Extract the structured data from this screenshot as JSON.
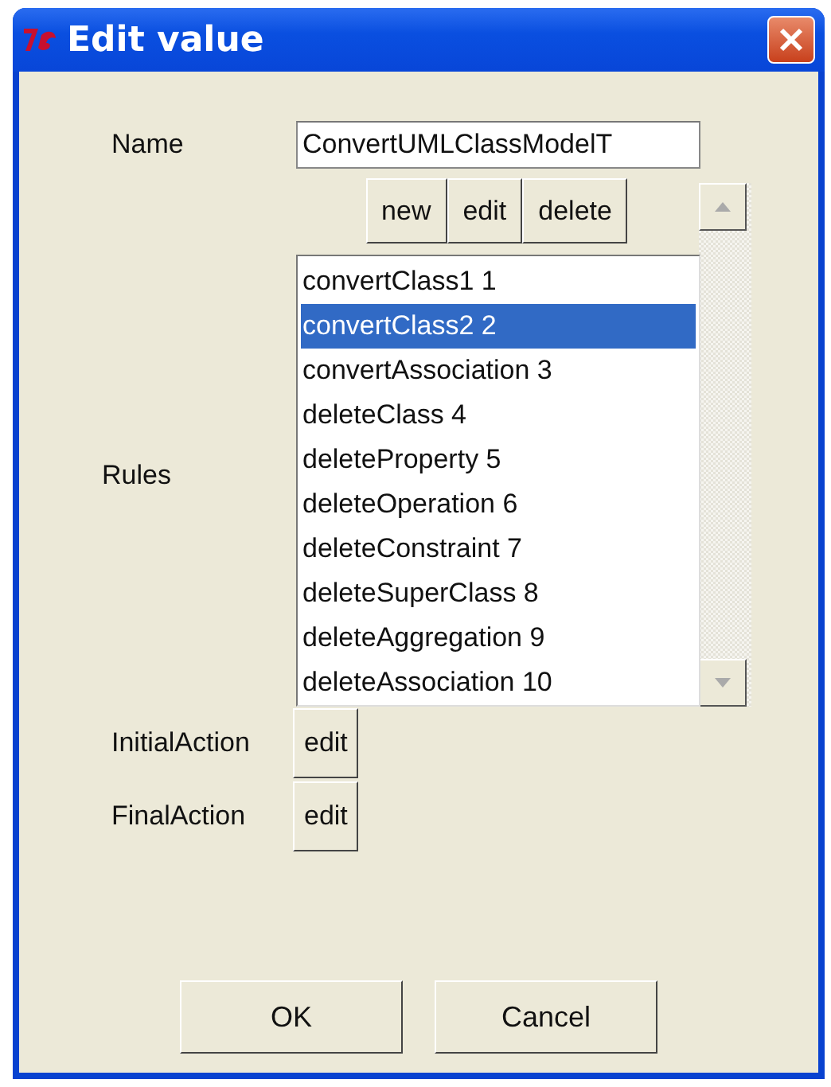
{
  "window": {
    "title": "Edit value"
  },
  "name": {
    "label": "Name",
    "value": "ConvertUMLClassModelT"
  },
  "rule_buttons": [
    "new",
    "edit",
    "delete"
  ],
  "rules": {
    "label": "Rules",
    "items": [
      {
        "text": "convertClass1 1",
        "selected": false
      },
      {
        "text": "convertClass2 2",
        "selected": true
      },
      {
        "text": "convertAssociation 3",
        "selected": false
      },
      {
        "text": "deleteClass 4",
        "selected": false
      },
      {
        "text": "deleteProperty 5",
        "selected": false
      },
      {
        "text": "deleteOperation 6",
        "selected": false
      },
      {
        "text": "deleteConstraint 7",
        "selected": false
      },
      {
        "text": "deleteSuperClass 8",
        "selected": false
      },
      {
        "text": "deleteAggregation 9",
        "selected": false
      },
      {
        "text": "deleteAssociation 10",
        "selected": false
      }
    ]
  },
  "actions": [
    {
      "label": "InitialAction",
      "button": "edit"
    },
    {
      "label": "FinalAction",
      "button": "edit"
    }
  ],
  "buttons": [
    "OK",
    "Cancel"
  ]
}
